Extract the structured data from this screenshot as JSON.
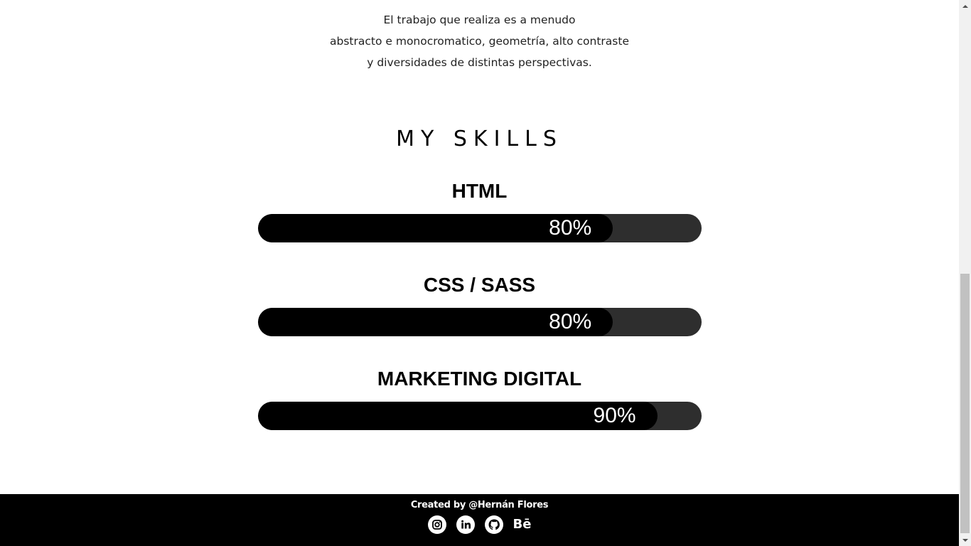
{
  "intro": {
    "lines": [
      "El trabajo que realiza es a menudo",
      "abstracto e monocromatico, geometría, alto contraste",
      "y diversidades de distintas perspectivas."
    ]
  },
  "skills": {
    "title": "MY SKILLS",
    "items": [
      {
        "name": "HTML",
        "percent_label": "80%",
        "level": 0.8
      },
      {
        "name": "CSS / SASS",
        "percent_label": "80%",
        "level": 0.8
      },
      {
        "name": "MARKETING DIGITAL",
        "percent_label": "90%",
        "level": 0.9
      }
    ]
  },
  "footer": {
    "credit": "Created by @Hernán Flores",
    "socials": [
      {
        "icon": "instagram-icon"
      },
      {
        "icon": "linkedin-icon"
      },
      {
        "icon": "github-icon"
      },
      {
        "icon": "behance-icon",
        "label": "Bē"
      }
    ]
  },
  "colors": {
    "bar_track": "#2e2e2e",
    "bar_fill": "#000000",
    "footer_bg": "#000000"
  }
}
